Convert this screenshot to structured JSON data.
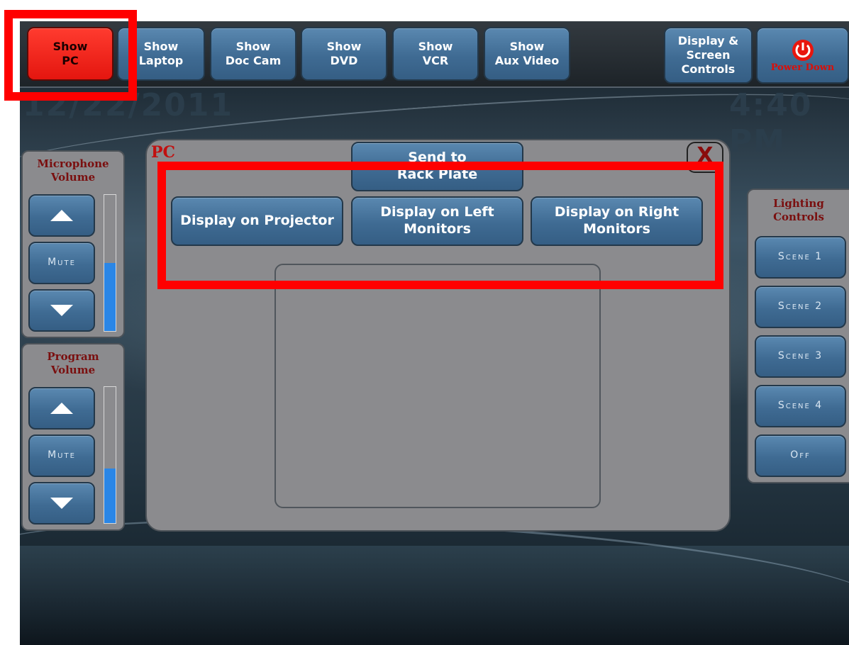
{
  "top_bar": {
    "show_pc": "Show\nPC",
    "show_laptop": "Show\nLaptop",
    "show_doc_cam": "Show\nDoc Cam",
    "show_dvd": "Show\nDVD",
    "show_vcr": "Show\nVCR",
    "show_aux_video": "Show\nAux Video",
    "display_screen_controls": "Display &\nScreen\nControls",
    "power_down": "Power Down"
  },
  "status": {
    "date": "12/22/2011",
    "time": "4:40 PM"
  },
  "microphone": {
    "title": "Microphone\nVolume",
    "mute": "Mute",
    "level_fraction": 0.5
  },
  "program": {
    "title": "Program\nVolume",
    "mute": "Mute",
    "level_fraction": 0.4
  },
  "main_panel": {
    "title": "PC",
    "close": "X",
    "send_to_rack_plate": "Send to\nRack Plate",
    "display_on_projector": "Display on Projector",
    "display_on_left_monitors": "Display on Left\nMonitors",
    "display_on_right_monitors": "Display on Right\nMonitors"
  },
  "lighting": {
    "title": "Lighting\nControls",
    "scenes": [
      "Scene 1",
      "Scene 2",
      "Scene 3",
      "Scene 4",
      "Off"
    ]
  },
  "colors": {
    "button_blue": "#3f6b93",
    "active_red": "#ff2a1f",
    "panel_gray": "#8b8b8e",
    "title_red": "#7a0f0f",
    "level_blue": "#2a86e6",
    "highlight_red": "#ff0000"
  }
}
